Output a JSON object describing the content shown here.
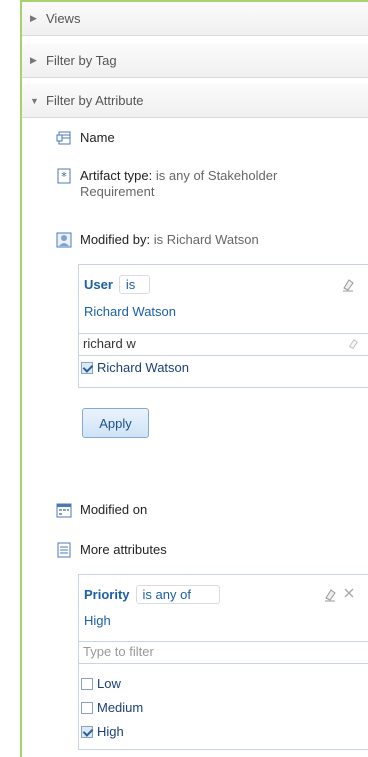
{
  "sections": {
    "views": "Views",
    "filter_by_tag": "Filter by Tag",
    "filter_by_attribute": "Filter by Attribute"
  },
  "attributes": {
    "name": "Name",
    "artifact_type_label": "Artifact type:",
    "artifact_type_value_line1": "is any of Stakeholder",
    "artifact_type_value_line2": "Requirement",
    "modified_by_label": "Modified by:",
    "modified_by_value": "is Richard Watson",
    "modified_on": "Modified on",
    "more_attributes": "More attributes"
  },
  "user_filter": {
    "label": "User",
    "operator": "is",
    "selected": "Richard Watson",
    "input_value": "richard w",
    "options": [
      {
        "label": "Richard Watson",
        "checked": true
      }
    ],
    "apply_label": "Apply"
  },
  "priority_filter": {
    "label": "Priority",
    "operator": "is any of",
    "selected": "High",
    "input_placeholder": "Type to filter",
    "options": [
      {
        "label": "Low",
        "checked": false
      },
      {
        "label": "Medium",
        "checked": false
      },
      {
        "label": "High",
        "checked": true
      }
    ]
  },
  "icons": {
    "clear": "eraser-icon",
    "close": "close-icon",
    "name": "name-icon",
    "artifact": "artifact-type-icon",
    "user": "user-icon",
    "calendar": "calendar-icon",
    "list": "list-icon"
  },
  "colors": {
    "accent_border": "#a7d36f",
    "link_blue": "#1b5fa9"
  }
}
